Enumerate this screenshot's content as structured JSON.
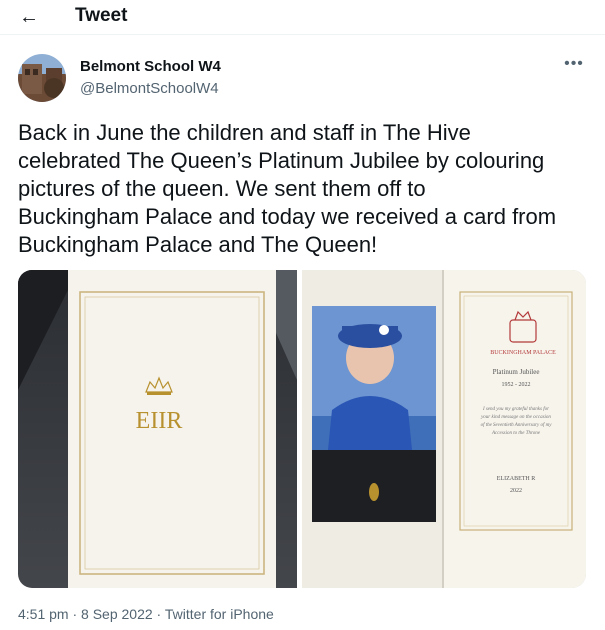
{
  "header": {
    "back_icon": "arrow-left-icon",
    "title": "Tweet"
  },
  "author": {
    "name": "Belmont School W4",
    "handle": "@BelmontSchoolW4",
    "more_icon": "more-horizontal-icon"
  },
  "tweet": {
    "text": "Back in June the children and staff in The Hive\ncelebrated The Queen’s Platinum Jubilee by colouring\npictures of the queen. We sent them off to\nBuckingham Palace and today we received a card from\nBuckingham Palace and The Queen!"
  },
  "card_front": {
    "monogram": "EIIR"
  },
  "card_inside": {
    "palace_label": "BUCKINGHAM PALACE",
    "heading": "Platinum Jubilee",
    "years": "1952 - 2022",
    "message": [
      "I send you my grateful thanks for",
      "your kind message on the occasion",
      "of the Seventieth Anniversary of my",
      "Accession to the Throne"
    ],
    "signature": "ELIZABETH R",
    "sign_year": "2022"
  },
  "meta": {
    "time": "4:51 pm",
    "sep1": " · ",
    "date": "8 Sep 2022",
    "sep2": " · ",
    "source": "Twitter for iPhone"
  },
  "colors": {
    "text": "#0f1419",
    "secondary": "#536471",
    "divider": "#eff3f4",
    "gold": "#b8912f"
  }
}
